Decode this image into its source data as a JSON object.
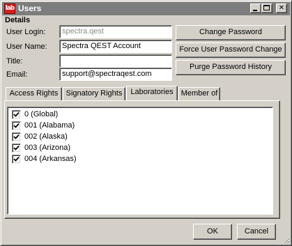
{
  "window": {
    "title": "Users",
    "app_icon": "lab",
    "icons": [
      "app-icon",
      "minimize-icon",
      "maximize-icon",
      "close-icon"
    ]
  },
  "details": {
    "heading": "Details",
    "user_login_label": "User Login:",
    "user_login_value": "spectra.qest",
    "user_name_label": "User Name:",
    "user_name_value": "Spectra QEST Account",
    "title_label": "Title:",
    "title_value": "",
    "email_label": "Email:",
    "email_value": "support@spectraqest.com"
  },
  "actions": {
    "change_password": "Change Password",
    "force_change": "Force User Password Change",
    "purge_history": "Purge Password History"
  },
  "tabs": [
    {
      "label": "Access Rights",
      "active": false
    },
    {
      "label": "Signatory Rights",
      "active": false
    },
    {
      "label": "Laboratories",
      "active": true
    },
    {
      "label": "Member of",
      "active": false
    }
  ],
  "laboratories": [
    {
      "label": "0 (Global)",
      "checked": true
    },
    {
      "label": "001 (Alabama)",
      "checked": true
    },
    {
      "label": "002 (Alaska)",
      "checked": true
    },
    {
      "label": "003 (Arizona)",
      "checked": true
    },
    {
      "label": "004 (Arkansas)",
      "checked": true
    }
  ],
  "footer": {
    "ok": "OK",
    "cancel": "Cancel"
  }
}
